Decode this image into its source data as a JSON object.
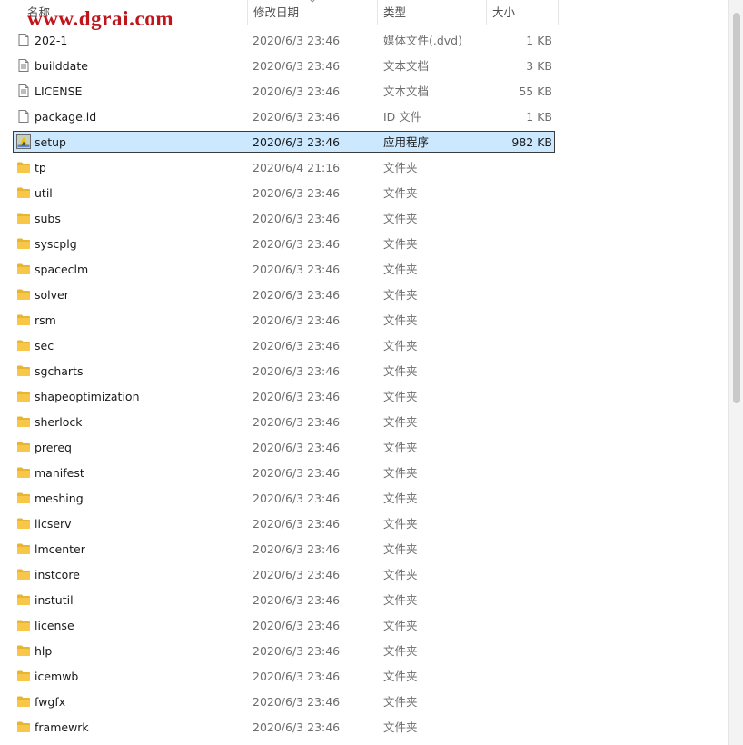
{
  "header": {
    "name": "名称",
    "date": "修改日期",
    "type": "类型",
    "size": "大小"
  },
  "watermark": "www.dgrai.com",
  "colors": {
    "selection_fill": "#cce8ff",
    "selection_border": "#3a3a3a",
    "folder": "#f8c74a",
    "watermark": "#c0151d"
  },
  "files": [
    {
      "name": "202-1",
      "date": "2020/6/3 23:46",
      "type": "媒体文件(.dvd)",
      "size": "1 KB",
      "icon": "file-icon"
    },
    {
      "name": "builddate",
      "date": "2020/6/3 23:46",
      "type": "文本文档",
      "size": "3 KB",
      "icon": "text-file-icon"
    },
    {
      "name": "LICENSE",
      "date": "2020/6/3 23:46",
      "type": "文本文档",
      "size": "55 KB",
      "icon": "text-file-icon"
    },
    {
      "name": "package.id",
      "date": "2020/6/3 23:46",
      "type": "ID 文件",
      "size": "1 KB",
      "icon": "file-icon"
    },
    {
      "name": "setup",
      "date": "2020/6/3 23:46",
      "type": "应用程序",
      "size": "982 KB",
      "icon": "app-icon",
      "selected": true
    },
    {
      "name": "tp",
      "date": "2020/6/4 21:16",
      "type": "文件夹",
      "size": "",
      "icon": "folder-icon"
    },
    {
      "name": "util",
      "date": "2020/6/3 23:46",
      "type": "文件夹",
      "size": "",
      "icon": "folder-icon"
    },
    {
      "name": "subs",
      "date": "2020/6/3 23:46",
      "type": "文件夹",
      "size": "",
      "icon": "folder-icon"
    },
    {
      "name": "syscplg",
      "date": "2020/6/3 23:46",
      "type": "文件夹",
      "size": "",
      "icon": "folder-icon"
    },
    {
      "name": "spaceclm",
      "date": "2020/6/3 23:46",
      "type": "文件夹",
      "size": "",
      "icon": "folder-icon"
    },
    {
      "name": "solver",
      "date": "2020/6/3 23:46",
      "type": "文件夹",
      "size": "",
      "icon": "folder-icon"
    },
    {
      "name": "rsm",
      "date": "2020/6/3 23:46",
      "type": "文件夹",
      "size": "",
      "icon": "folder-icon"
    },
    {
      "name": "sec",
      "date": "2020/6/3 23:46",
      "type": "文件夹",
      "size": "",
      "icon": "folder-icon"
    },
    {
      "name": "sgcharts",
      "date": "2020/6/3 23:46",
      "type": "文件夹",
      "size": "",
      "icon": "folder-icon"
    },
    {
      "name": "shapeoptimization",
      "date": "2020/6/3 23:46",
      "type": "文件夹",
      "size": "",
      "icon": "folder-icon"
    },
    {
      "name": "sherlock",
      "date": "2020/6/3 23:46",
      "type": "文件夹",
      "size": "",
      "icon": "folder-icon"
    },
    {
      "name": "prereq",
      "date": "2020/6/3 23:46",
      "type": "文件夹",
      "size": "",
      "icon": "folder-icon"
    },
    {
      "name": "manifest",
      "date": "2020/6/3 23:46",
      "type": "文件夹",
      "size": "",
      "icon": "folder-icon"
    },
    {
      "name": "meshing",
      "date": "2020/6/3 23:46",
      "type": "文件夹",
      "size": "",
      "icon": "folder-icon"
    },
    {
      "name": "licserv",
      "date": "2020/6/3 23:46",
      "type": "文件夹",
      "size": "",
      "icon": "folder-icon"
    },
    {
      "name": "lmcenter",
      "date": "2020/6/3 23:46",
      "type": "文件夹",
      "size": "",
      "icon": "folder-icon"
    },
    {
      "name": "instcore",
      "date": "2020/6/3 23:46",
      "type": "文件夹",
      "size": "",
      "icon": "folder-icon"
    },
    {
      "name": "instutil",
      "date": "2020/6/3 23:46",
      "type": "文件夹",
      "size": "",
      "icon": "folder-icon"
    },
    {
      "name": "license",
      "date": "2020/6/3 23:46",
      "type": "文件夹",
      "size": "",
      "icon": "folder-icon"
    },
    {
      "name": "hlp",
      "date": "2020/6/3 23:46",
      "type": "文件夹",
      "size": "",
      "icon": "folder-icon"
    },
    {
      "name": "icemwb",
      "date": "2020/6/3 23:46",
      "type": "文件夹",
      "size": "",
      "icon": "folder-icon"
    },
    {
      "name": "fwgfx",
      "date": "2020/6/3 23:46",
      "type": "文件夹",
      "size": "",
      "icon": "folder-icon"
    },
    {
      "name": "framewrk",
      "date": "2020/6/3 23:46",
      "type": "文件夹",
      "size": "",
      "icon": "folder-icon"
    }
  ]
}
